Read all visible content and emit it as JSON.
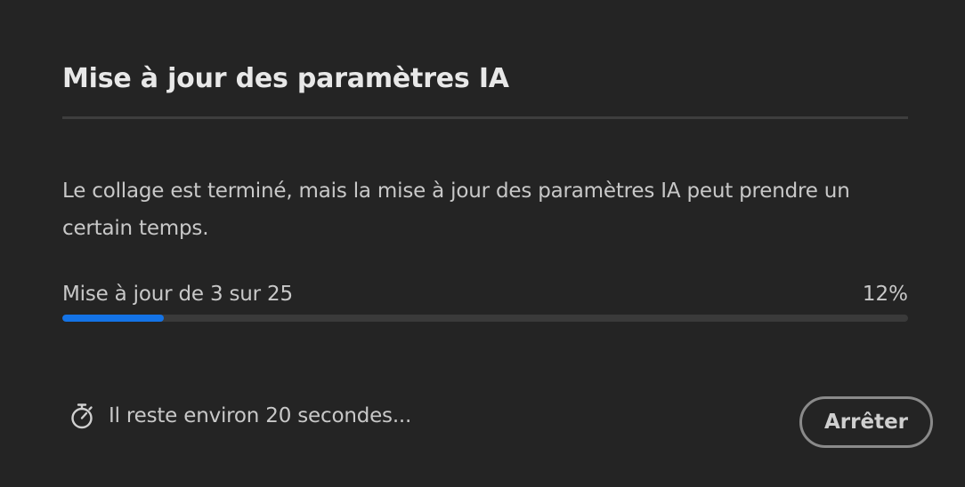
{
  "dialog": {
    "title": "Mise à jour des paramètres IA",
    "description": "Le collage est terminé, mais la mise à jour des paramètres IA peut prendre un certain temps.",
    "progress": {
      "label": "Mise à jour de 3 sur 25",
      "percent_text": "12%",
      "fraction": 0.12,
      "color": "#1473e6"
    },
    "status": {
      "icon": "stopwatch-icon",
      "text": "Il reste environ 20 secondes..."
    },
    "buttons": {
      "stop_label": "Arrêter"
    }
  }
}
